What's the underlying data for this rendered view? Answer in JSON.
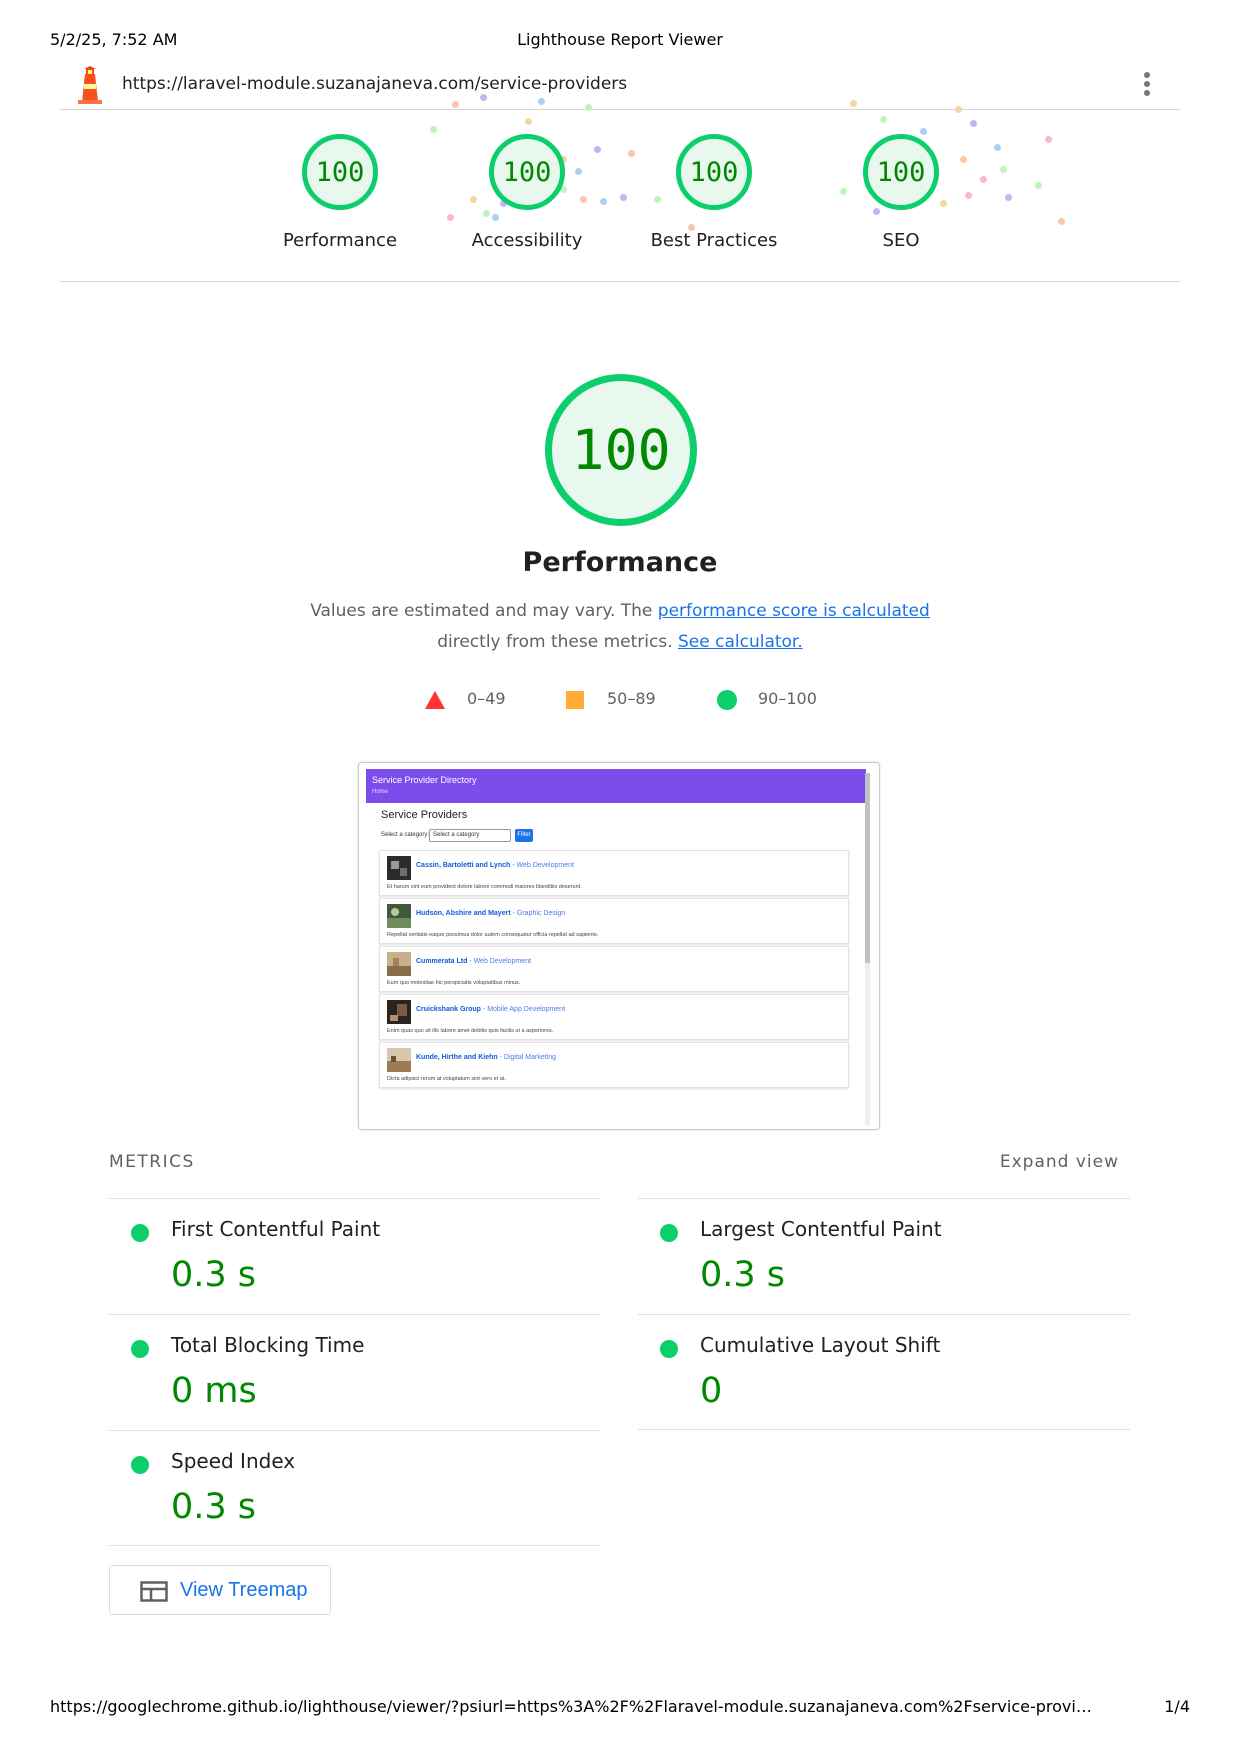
{
  "print_header": {
    "date": "5/2/25, 7:52 AM",
    "title": "Lighthouse Report Viewer"
  },
  "topbar": {
    "url": "https://laravel-module.suzanajaneva.com/service-providers",
    "logo_icon": "lighthouse-logo-icon",
    "menu_icon": "more-vert-icon"
  },
  "categories": [
    {
      "label": "Performance",
      "score": "100"
    },
    {
      "label": "Accessibility",
      "score": "100"
    },
    {
      "label": "Best Practices",
      "score": "100"
    },
    {
      "label": "SEO",
      "score": "100"
    }
  ],
  "main_gauge": {
    "score": "100",
    "title": "Performance"
  },
  "description": {
    "text1": "Values are estimated and may vary. The ",
    "link1": "performance score is calculated",
    "text2": "directly from these metrics. ",
    "link2": "See calculator."
  },
  "legend": [
    {
      "range": "0–49",
      "color": "#ff3333",
      "shape": "triangle"
    },
    {
      "range": "50–89",
      "color": "#ffaa33",
      "shape": "square"
    },
    {
      "range": "90–100",
      "color": "#0cce6b",
      "shape": "circle"
    }
  ],
  "screenshot": {
    "header_title": "Service Provider Directory",
    "header_sub": "Home",
    "heading": "Service Providers",
    "filter_label": "Select a category:",
    "filter_value": "Select a category",
    "filter_button": "Filter",
    "cards": [
      {
        "name": "Cassin, Bartoletti and Lynch",
        "category": "- Web Development",
        "desc": "Et harum sint eum provident dolore labore commodi maiores blanditiis deserunt."
      },
      {
        "name": "Hudson, Abshire and Mayert",
        "category": "- Graphic Design",
        "desc": "Repellat veritatis eaque possimus dolor autem consequatur officia repellat ad sapiente."
      },
      {
        "name": "Cummerata Ltd",
        "category": "- Web Development",
        "desc": "Eum quo molestiae hic perspiciatis voluptatibus minus."
      },
      {
        "name": "Cruickshank Group",
        "category": "- Mobile App Development",
        "desc": "Enim quas quo sit illo labore amet debitis quis facilis ut a asperiores."
      },
      {
        "name": "Kunde, Hirthe and Kiehn",
        "category": "- Digital Marketing",
        "desc": "Dicta adipisci rerum at voluptatum sint vero et at."
      }
    ]
  },
  "metrics_header": {
    "title": "METRICS",
    "expand": "Expand view"
  },
  "metrics": [
    {
      "title": "First Contentful Paint",
      "value": "0.3 s"
    },
    {
      "title": "Largest Contentful Paint",
      "value": "0.3 s"
    },
    {
      "title": "Total Blocking Time",
      "value": "0 ms"
    },
    {
      "title": "Cumulative Layout Shift",
      "value": "0"
    },
    {
      "title": "Speed Index",
      "value": "0.3 s"
    }
  ],
  "treemap_button": {
    "label": "View Treemap",
    "icon": "treemap-icon"
  },
  "print_footer": {
    "url": "https://googlechrome.github.io/lighthouse/viewer/?psiurl=https%3A%2F%2Flaravel-module.suzanajaneva.com%2Fservice-provi…",
    "page": "1/4"
  },
  "colors": {
    "pass": "#0cce6b",
    "pass_text": "#008800",
    "link": "#1a73e8",
    "screenshot_header": "#7c4dea"
  }
}
